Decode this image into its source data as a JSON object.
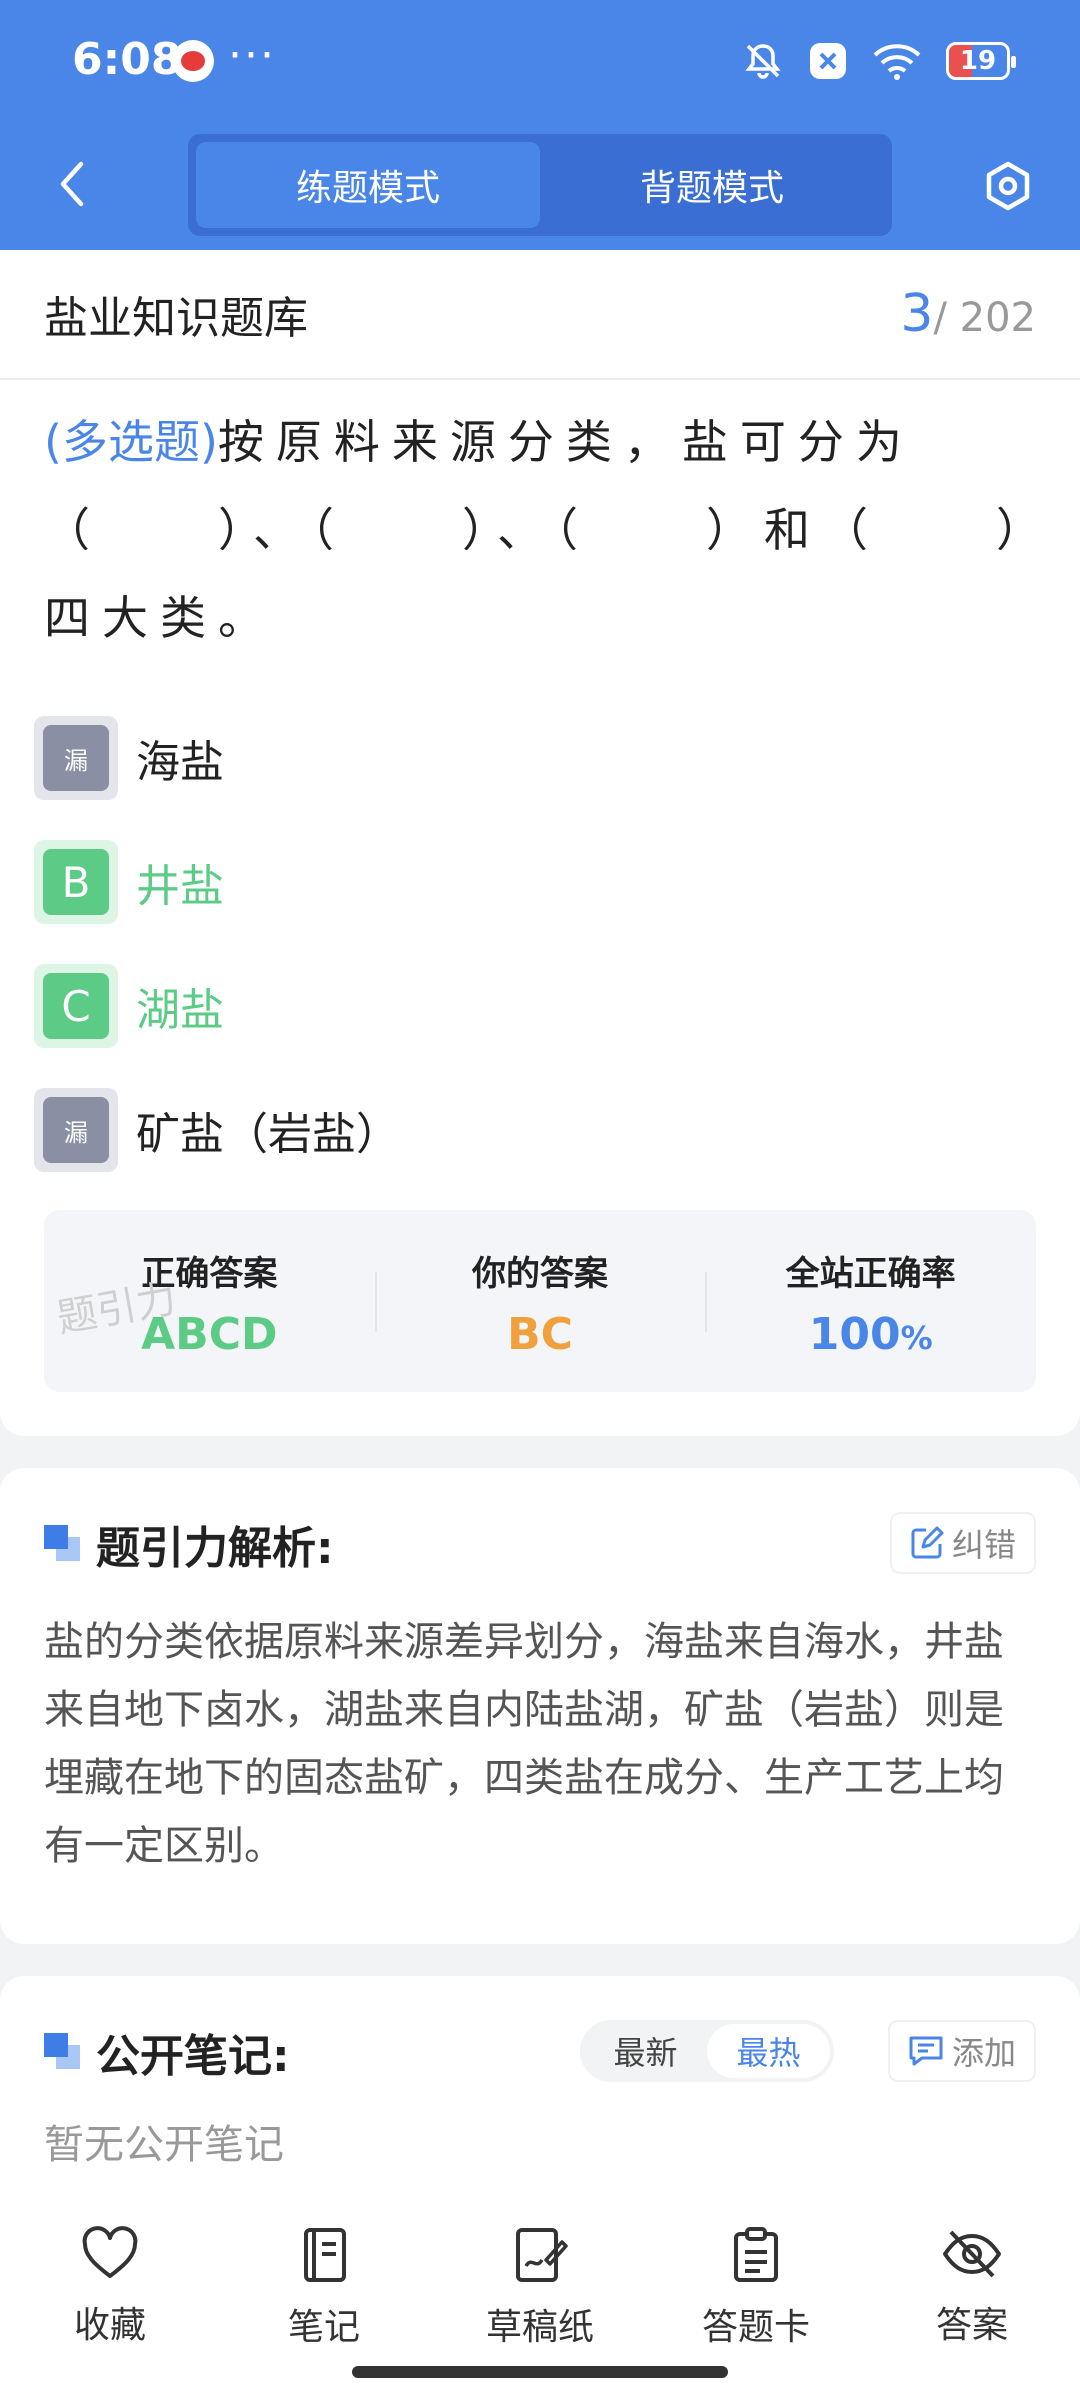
{
  "status_bar": {
    "time": "6:08",
    "more": "···",
    "battery": "19",
    "colors": {
      "accent": "#4a86e8",
      "battery_low": "#e95050"
    }
  },
  "nav": {
    "modes": [
      "练题模式",
      "背题模式"
    ],
    "active_mode": 0
  },
  "bank": {
    "title": "盐业知识题库",
    "current": "3",
    "total": "/ 202"
  },
  "question": {
    "type": "(多选题)",
    "text": "按原料来源分类，盐可分为（　　）、（　　）、（　　）和（　　）四大类。"
  },
  "options": [
    {
      "badge": "漏",
      "text": "海盐",
      "state": "missed"
    },
    {
      "badge": "B",
      "text": "井盐",
      "state": "correct"
    },
    {
      "badge": "C",
      "text": "湖盐",
      "state": "correct"
    },
    {
      "badge": "漏",
      "text": "矿盐（岩盐）",
      "state": "missed"
    }
  ],
  "stats": {
    "correct_label": "正确答案",
    "correct_value": "ABCD",
    "yours_label": "你的答案",
    "yours_value": "BC",
    "rate_label": "全站正确率",
    "rate_value": "100",
    "rate_unit": "%"
  },
  "watermark": "题引力",
  "analysis": {
    "title": "题引力解析:",
    "report_label": "纠错",
    "text": "盐的分类依据原料来源差异划分，海盐来自海水，井盐来自地下卤水，湖盐来自内陆盐湖，矿盐（岩盐）则是埋藏在地下的固态盐矿，四类盐在成分、生产工艺上均有一定区别。"
  },
  "notes": {
    "title": "公开笔记:",
    "sort_options": [
      "最新",
      "最热"
    ],
    "active_sort": 1,
    "add_label": "添加",
    "empty_text": "暂无公开笔记"
  },
  "bottom_bar": [
    {
      "label": "收藏",
      "icon": "heart-icon"
    },
    {
      "label": "笔记",
      "icon": "notebook-icon"
    },
    {
      "label": "草稿纸",
      "icon": "draft-icon"
    },
    {
      "label": "答题卡",
      "icon": "answer-card-icon"
    },
    {
      "label": "答案",
      "icon": "eye-off-icon"
    }
  ]
}
